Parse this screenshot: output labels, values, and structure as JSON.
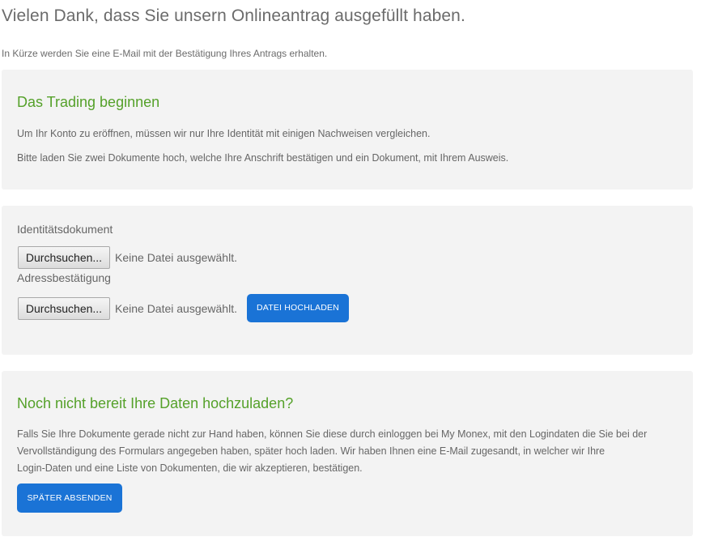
{
  "header": {
    "title": "Vielen Dank, dass Sie unsern Onlineantrag ausgefüllt haben.",
    "subtitle": "In Kürze werden Sie eine E-Mail mit der Bestätigung Ihres Antrags erhalten."
  },
  "trading": {
    "heading": "Das Trading beginnen",
    "line1": "Um Ihr Konto zu eröffnen, müssen wir nur Ihre Identität mit einigen Nachweisen vergleichen.",
    "line2": "Bitte laden Sie zwei Dokumente hoch, welche Ihre Anschrift bestätigen und ein Dokument, mit Ihrem Ausweis."
  },
  "upload": {
    "identity_label": "Identitätsdokument",
    "identity_button": "Durchsuchen...",
    "identity_status": "Keine Datei ausgewählt.",
    "address_label": "Adressbestätigung",
    "address_button": "Durchsuchen...",
    "address_status": "Keine Datei ausgewählt.",
    "upload_button": "DATEI HOCHLADEN"
  },
  "later": {
    "heading": "Noch nicht bereit Ihre Daten hochzuladen?",
    "text_line1": "Falls Sie Ihre Dokumente gerade nicht zur Hand haben, können Sie diese durch einloggen bei My Monex, mit den Logindaten die Sie bei der",
    "text_line2": "Vervollständigung des Formulars angegeben haben, später hoch laden. Wir haben Ihnen eine E-Mail zugesandt, in welcher wir Ihre",
    "text_line3": "Login-Daten und eine Liste von Dokumenten, die wir akzeptieren, bestätigen.",
    "button": "SPÄTER ABSENDEN"
  },
  "colors": {
    "accent_green": "#55a12a",
    "button_blue": "#1a73d6",
    "panel_bg": "#f3f3f3"
  }
}
